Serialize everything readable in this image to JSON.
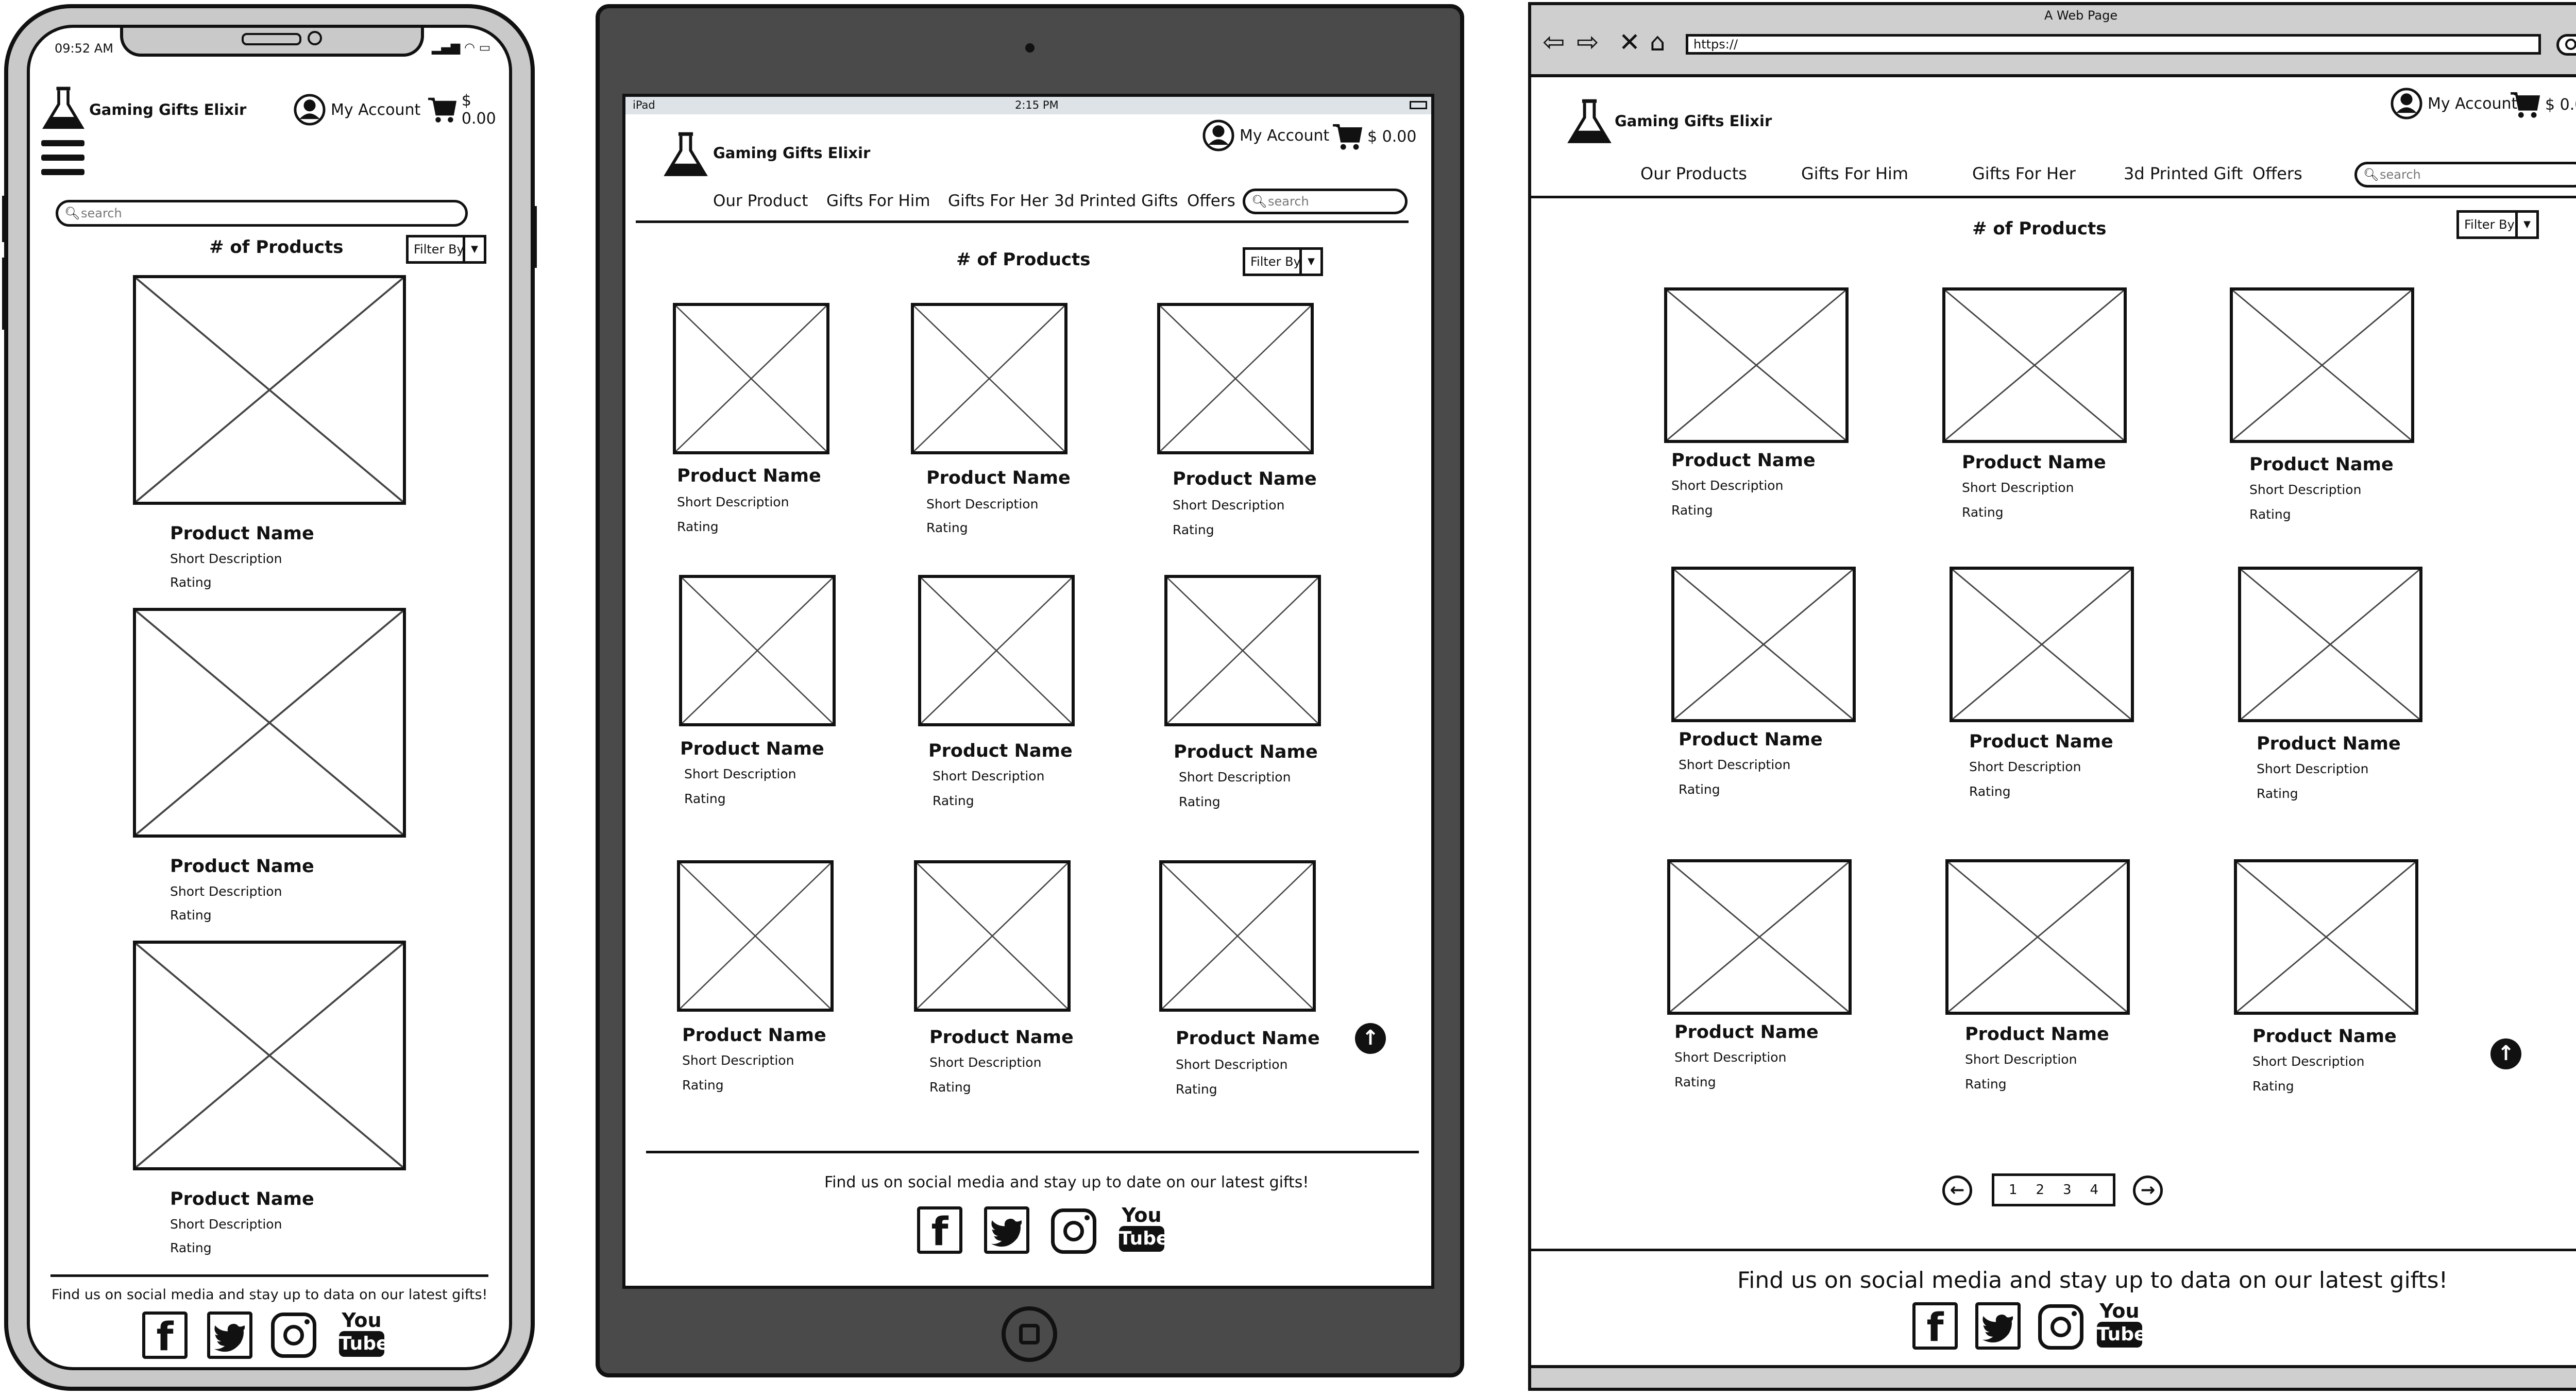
{
  "brand": {
    "name": "Gaming Gifts Elixir"
  },
  "account": {
    "label": "My Account"
  },
  "cart": {
    "total": "$ 0.00"
  },
  "nav_tablet": [
    "Our Product",
    "Gifts For Him",
    "Gifts For Her",
    "3d Printed Gifts",
    "Offers"
  ],
  "nav_desktop": [
    "Our Products",
    "Gifts For Him",
    "Gifts For Her",
    "3d Printed Gift",
    "Offers"
  ],
  "search": {
    "placeholder": "search"
  },
  "filter": {
    "label": "Filter By"
  },
  "products_heading": "# of Products",
  "product": {
    "name": "Product Name",
    "desc": "Short Description",
    "rating": "Rating"
  },
  "footer": {
    "social_text_tablet": "Find us on social media and stay up to date on our latest gifts!",
    "social_text_mobile": "Find us on social media and stay up to data on our latest gifts!",
    "social_text_desktop": "Find us on social media and stay up to data on our latest gifts!",
    "youtube_top": "You",
    "youtube_bottom": "Tube"
  },
  "phone": {
    "time": "09:52 AM"
  },
  "tablet": {
    "device": "iPad",
    "time": "2:15 PM"
  },
  "browser": {
    "title": "A Web Page",
    "url": "https://"
  },
  "pagination": [
    "1",
    "2",
    "3",
    "4"
  ],
  "icons": {
    "brand": "flask-icon",
    "account": "user-circle-icon",
    "cart": "cart-icon",
    "menu": "hamburger-menu-icon",
    "search": "search-icon",
    "top": "arrow-up-circle-icon",
    "facebook": "facebook-icon",
    "twitter": "twitter-icon",
    "instagram": "instagram-icon",
    "youtube": "youtube-icon"
  }
}
